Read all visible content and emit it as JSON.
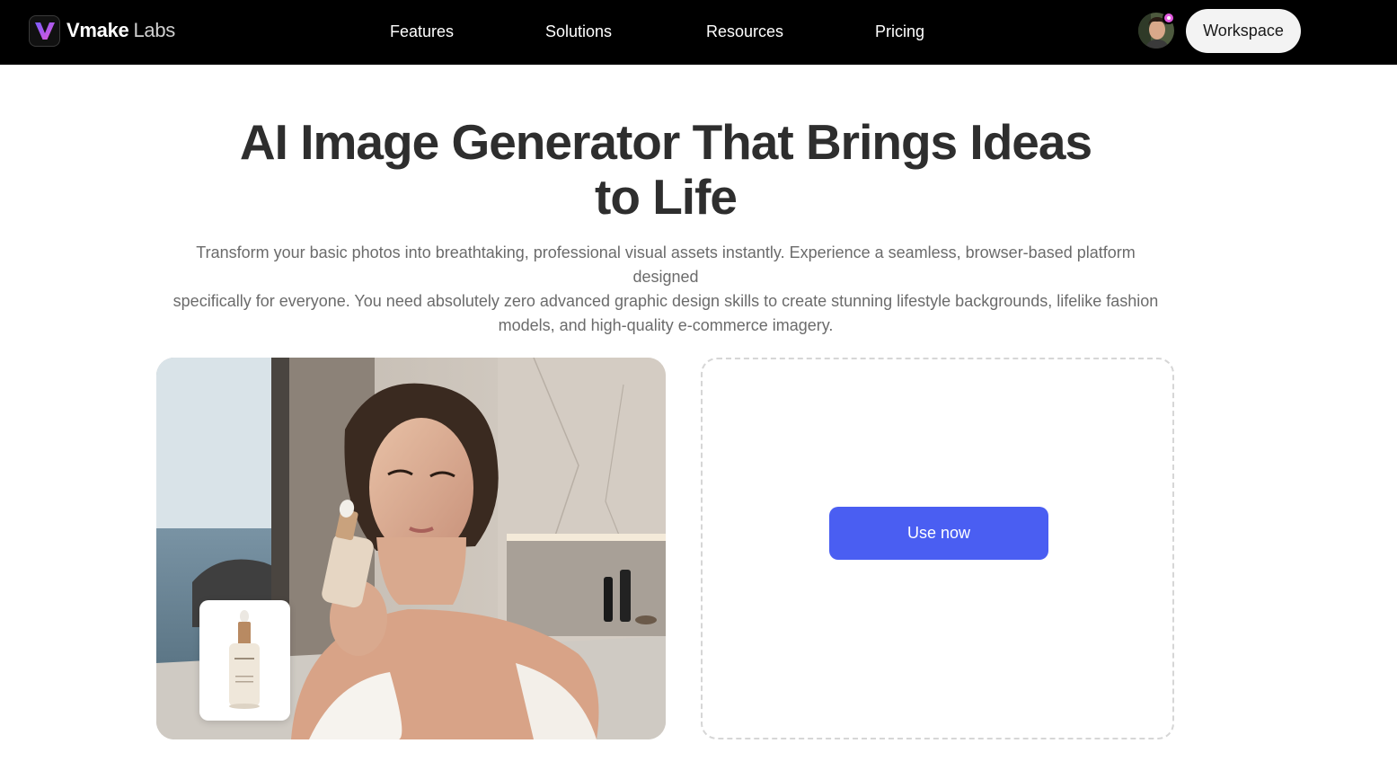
{
  "brand": {
    "name": "Vmake",
    "suffix": "Labs",
    "logo_icon": "v-logo-icon",
    "accent": "#a64dff"
  },
  "nav": {
    "items": [
      {
        "label": "Features"
      },
      {
        "label": "Solutions"
      },
      {
        "label": "Resources"
      },
      {
        "label": "Pricing"
      }
    ],
    "workspace_label": "Workspace",
    "avatar_icon": "user-avatar",
    "badge_color": "#e35be0"
  },
  "hero": {
    "title_line1": "AI Image Generator That Brings Ideas",
    "title_line2": "to Life",
    "description_line1": "Transform your basic photos into breathtaking, professional visual assets instantly. Experience a seamless, browser-based platform designed",
    "description_line2": "specifically for everyone. You need absolutely zero advanced graphic design skills to create stunning lifestyle backgrounds, lifelike fashion",
    "description_line3": "models, and high-quality e-commerce imagery."
  },
  "showcase": {
    "image_description_icon": "model-with-serum-photo",
    "product_icon": "serum-bottle-icon"
  },
  "upload": {
    "button_label": "Use now",
    "button_color": "#4a5ef2"
  }
}
